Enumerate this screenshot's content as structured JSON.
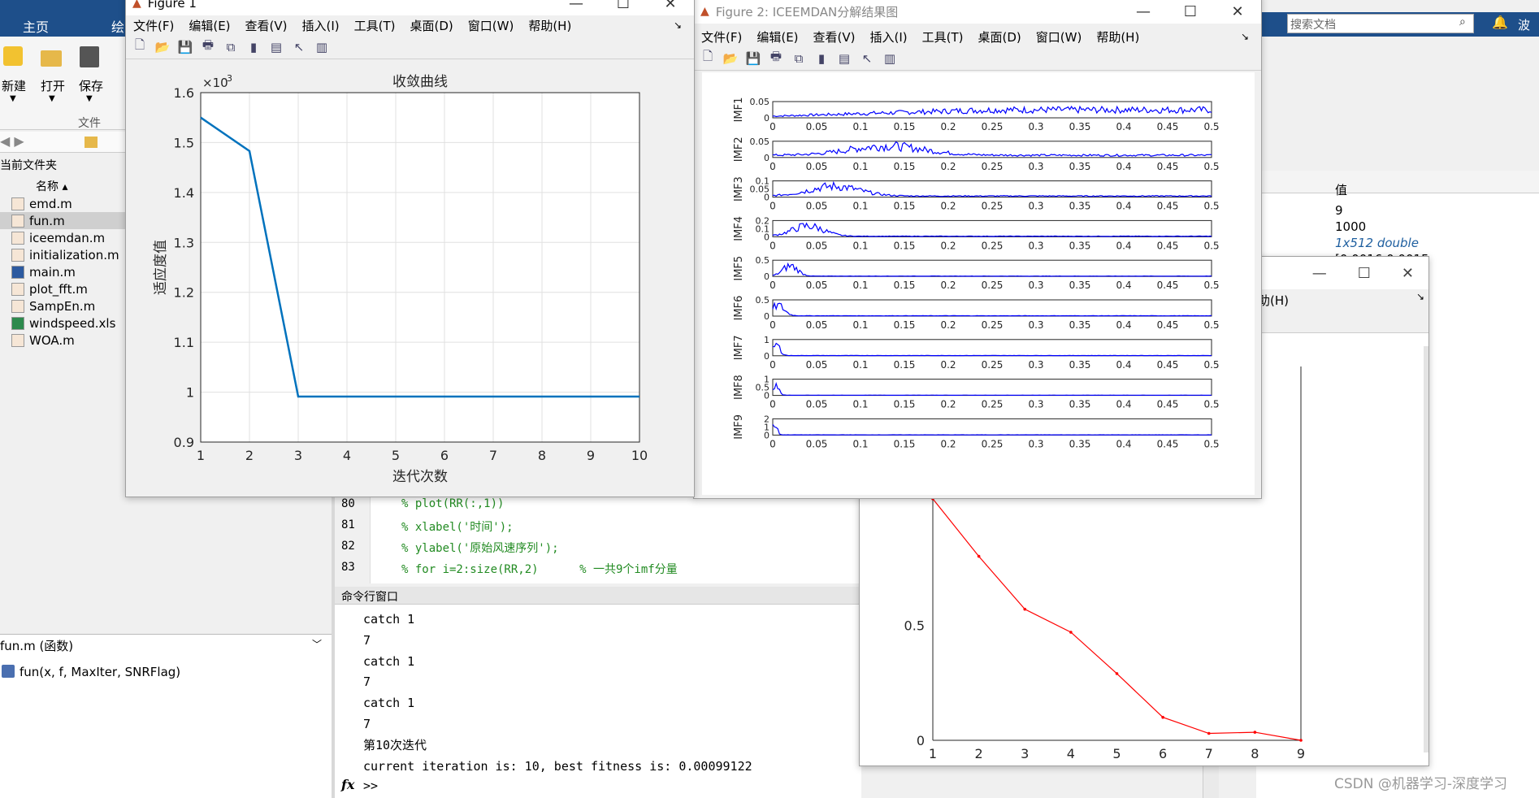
{
  "main": {
    "tabs": [
      "主页",
      "绘"
    ],
    "search_placeholder": "搜索文档",
    "user": "波",
    "toolstrip": {
      "new": "新建",
      "open": "打开",
      "save": "保存",
      "group": "文件"
    },
    "folder_panel_title": "当前文件夹",
    "name_header": "名称 ▴",
    "files": [
      {
        "name": "emd.m",
        "icon": "fx"
      },
      {
        "name": "fun.m",
        "icon": "fx"
      },
      {
        "name": "iceemdan.m",
        "icon": "fx"
      },
      {
        "name": "initialization.m",
        "icon": "fx"
      },
      {
        "name": "main.m",
        "icon": "m"
      },
      {
        "name": "plot_fft.m",
        "icon": "fx"
      },
      {
        "name": "SampEn.m",
        "icon": "fx"
      },
      {
        "name": "windspeed.xls",
        "icon": "xls"
      },
      {
        "name": "WOA.m",
        "icon": "fx"
      }
    ],
    "details_title": "fun.m  (函数)",
    "details_sig": "fun(x, f, MaxIter, SNRFlag)",
    "workspace_header": "值",
    "workspace_values": [
      "9",
      "1000",
      "1x512 double",
      "[0.0016 0.0015"
    ],
    "editor_lines": [
      {
        "num": "80",
        "text": "% plot(RR(:,1))"
      },
      {
        "num": "81",
        "text": "% xlabel('时间');"
      },
      {
        "num": "82",
        "text": "% ylabel('原始风速序列');"
      },
      {
        "num": "83",
        "text": "% for i=2:size(RR,2)      % 一共9个imf分量"
      }
    ],
    "cmd_title": "命令行窗口",
    "cmd_lines": [
      "catch 1",
      "7",
      "catch 1",
      "7",
      "catch 1",
      "7",
      "第10次迭代",
      "current iteration is: 10, best fitness is: 0.00099122"
    ],
    "prompt": ">>",
    "fx": "fx"
  },
  "fig1": {
    "title": "Figure 1",
    "menus": [
      "文件(F)",
      "编辑(E)",
      "查看(V)",
      "插入(I)",
      "工具(T)",
      "桌面(D)",
      "窗口(W)",
      "帮助(H)"
    ],
    "exponent": "×10",
    "exponent_power": "-3"
  },
  "fig2": {
    "title": "Figure 2: ICEEMDAN分解结果图",
    "menus": [
      "文件(F)",
      "编辑(E)",
      "查看(V)",
      "插入(I)",
      "工具(T)",
      "桌面(D)",
      "窗口(W)",
      "帮助(H)"
    ]
  },
  "fig3": {
    "menu_frag": "助(H)"
  },
  "watermark": "CSDN @机器学习-深度学习",
  "chart_data": [
    {
      "type": "line",
      "title": "收敛曲线",
      "xlabel": "迭代次数",
      "ylabel": "适应度值",
      "x": [
        1,
        2,
        3,
        4,
        5,
        6,
        7,
        8,
        9,
        10
      ],
      "y": [
        0.00155,
        0.001483,
        0.00099122,
        0.00099122,
        0.00099122,
        0.00099122,
        0.00099122,
        0.00099122,
        0.00099122,
        0.00099122
      ],
      "xlim": [
        1,
        10
      ],
      "ylim": [
        0.0009,
        0.0016
      ],
      "xticks": [
        "1",
        "2",
        "3",
        "4",
        "5",
        "6",
        "7",
        "8",
        "9",
        "10"
      ],
      "yticks": [
        "0.9",
        "1",
        "1.1",
        "1.2",
        "1.3",
        "1.4",
        "1.5",
        "1.6"
      ],
      "grid": true,
      "color": "#0072bd"
    },
    {
      "type": "line",
      "title": "",
      "xlabel": "",
      "ylabel": "",
      "xticks": [
        "0",
        "0.05",
        "0.1",
        "0.15",
        "0.2",
        "0.25",
        "0.3",
        "0.35",
        "0.4",
        "0.45",
        "0.5"
      ],
      "xlim": [
        0,
        0.5
      ],
      "color": "#0000ff",
      "series": [
        {
          "name": "IMF1",
          "yticks": [
            "0.05",
            "0"
          ]
        },
        {
          "name": "IMF2",
          "yticks": [
            "0.05",
            "0"
          ]
        },
        {
          "name": "IMF3",
          "yticks": [
            "0.1",
            "0.05",
            "0"
          ]
        },
        {
          "name": "IMF4",
          "yticks": [
            "0.2",
            "0.1",
            "0"
          ]
        },
        {
          "name": "IMF5",
          "yticks": [
            "0.5",
            "0"
          ]
        },
        {
          "name": "IMF6",
          "yticks": [
            "0.5",
            "0"
          ]
        },
        {
          "name": "IMF7",
          "yticks": [
            "1",
            "0"
          ]
        },
        {
          "name": "IMF8",
          "yticks": [
            "1",
            "0.5",
            "0"
          ]
        },
        {
          "name": "IMF9",
          "yticks": [
            "2",
            "1",
            "0"
          ]
        }
      ]
    },
    {
      "type": "line",
      "title": "",
      "xlabel": "",
      "ylabel": "",
      "x": [
        1,
        2,
        3,
        4,
        5,
        6,
        7,
        8,
        9
      ],
      "y": [
        1.05,
        0.8,
        0.57,
        0.47,
        0.29,
        0.1,
        0.03,
        0.035,
        0.0
      ],
      "xlim": [
        1,
        9
      ],
      "ylim": [
        0,
        1.1
      ],
      "xticks": [
        "1",
        "2",
        "3",
        "4",
        "5",
        "6",
        "7",
        "8",
        "9"
      ],
      "yticks": [
        "0",
        "0.5"
      ],
      "color": "#ff0000"
    }
  ]
}
